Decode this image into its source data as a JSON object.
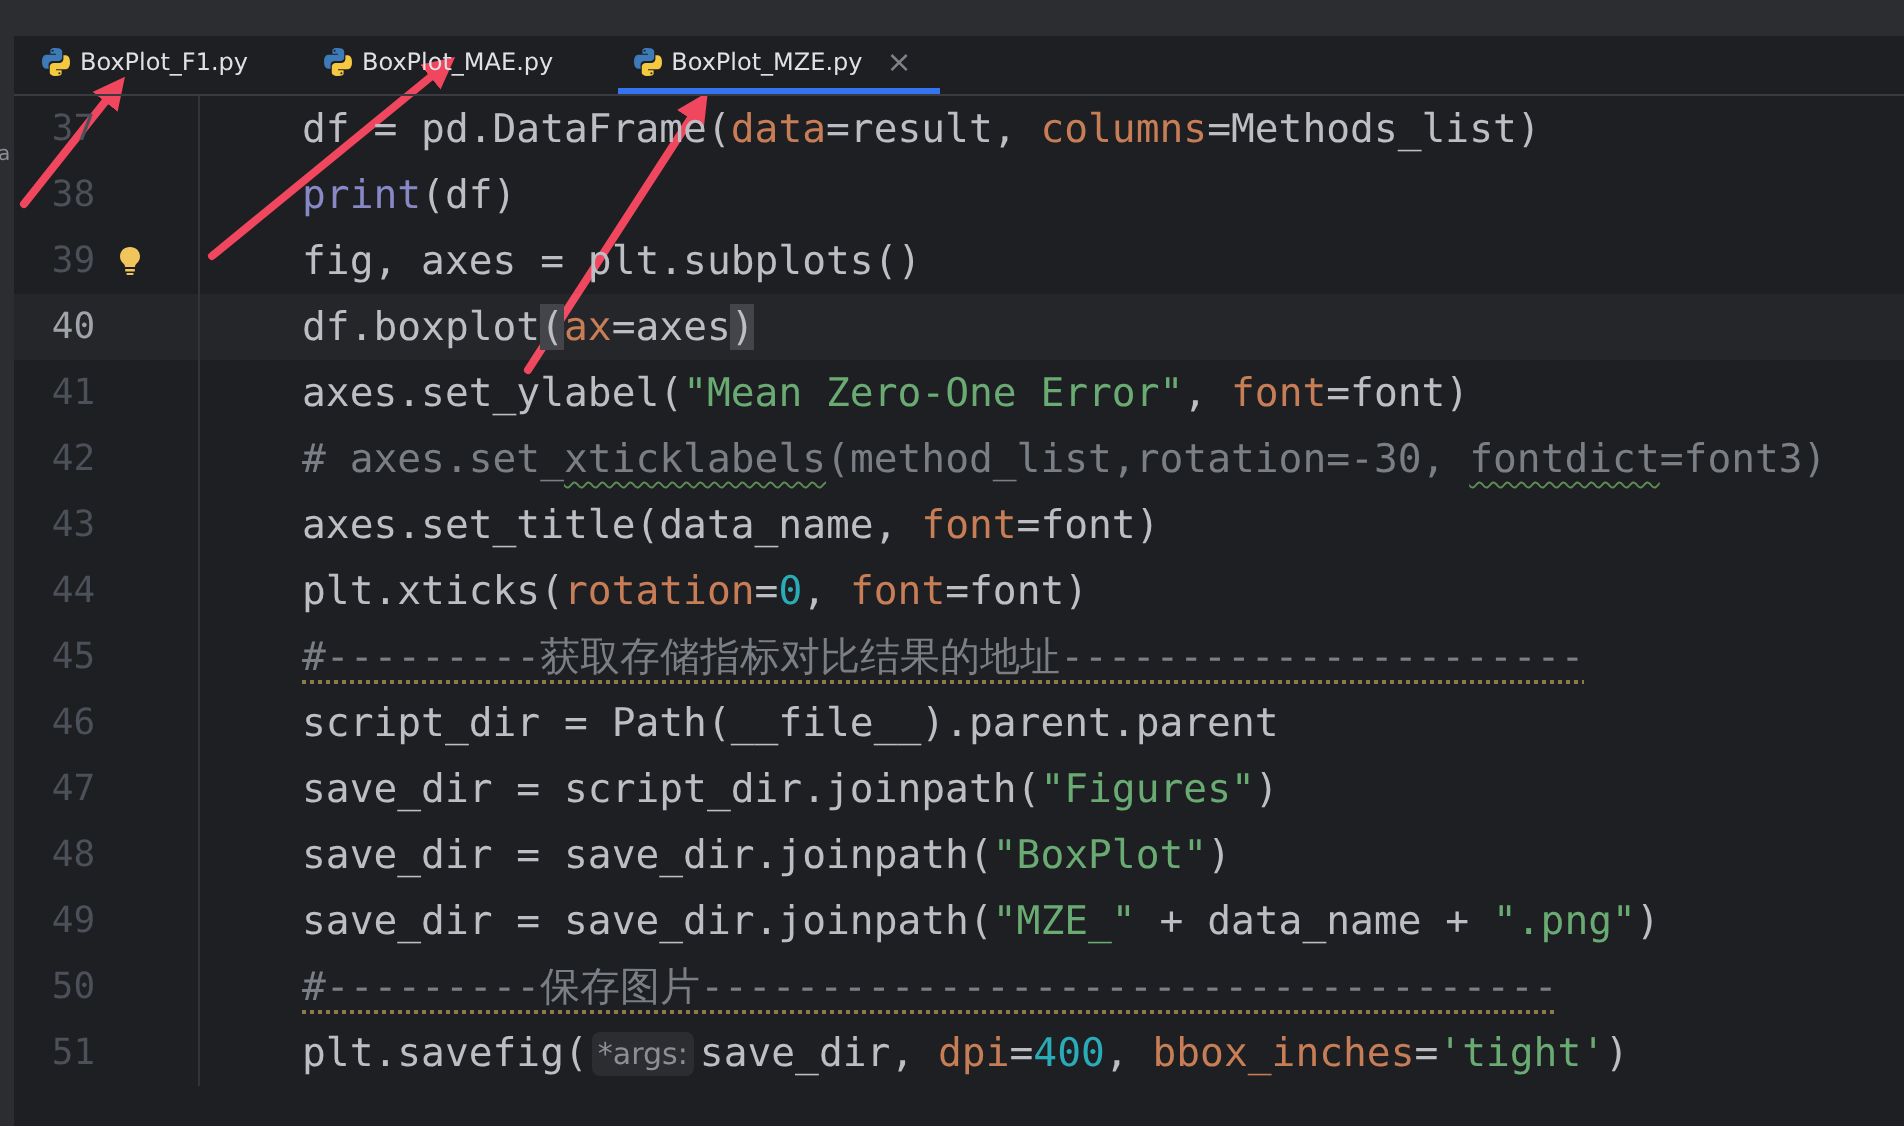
{
  "side_panel": {
    "text": "a"
  },
  "tabs": [
    {
      "label": "BoxPlot_F1.py",
      "selected": false
    },
    {
      "label": "BoxPlot_MAE.py",
      "selected": false
    },
    {
      "label": "BoxPlot_MZE.py",
      "selected": true,
      "close": "×"
    }
  ],
  "editor": {
    "lines": [
      {
        "number": "37",
        "current": false,
        "segments": [
          {
            "t": "df = pd.DataFrame(",
            "kind": "plain"
          },
          {
            "t": "data",
            "kind": "param"
          },
          {
            "t": "=result, ",
            "kind": "plain"
          },
          {
            "t": "columns",
            "kind": "param"
          },
          {
            "t": "=Methods_list)",
            "kind": "plain"
          }
        ]
      },
      {
        "number": "38",
        "current": false,
        "segments": [
          {
            "t": "print",
            "kind": "builtin"
          },
          {
            "t": "(df)",
            "kind": "plain"
          }
        ]
      },
      {
        "number": "39",
        "current": false,
        "lightbulb": true,
        "segments": [
          {
            "t": "fig, axes = plt.subplots()",
            "kind": "plain"
          }
        ]
      },
      {
        "number": "40",
        "current": true,
        "segments": [
          {
            "t": "df.boxplot",
            "kind": "plain"
          },
          {
            "t": "(",
            "kind": "plain",
            "matched": true
          },
          {
            "t": "ax",
            "kind": "param"
          },
          {
            "t": "=axes",
            "kind": "plain"
          },
          {
            "t": ")",
            "kind": "plain",
            "matched": true
          }
        ]
      },
      {
        "number": "41",
        "current": false,
        "segments": [
          {
            "t": "axes.set_ylabel(",
            "kind": "plain"
          },
          {
            "t": "\"Mean Zero-One Error\"",
            "kind": "string"
          },
          {
            "t": ", ",
            "kind": "plain"
          },
          {
            "t": "font",
            "kind": "param"
          },
          {
            "t": "=font)",
            "kind": "plain"
          }
        ]
      },
      {
        "number": "42",
        "current": false,
        "segments": [
          {
            "t": "# axes.set_",
            "kind": "comment"
          },
          {
            "t": "xticklabels",
            "kind": "comment",
            "spellcheck": true
          },
          {
            "t": "(method_list,rotation=-30, ",
            "kind": "comment"
          },
          {
            "t": "fontdict",
            "kind": "comment",
            "spellcheck": true
          },
          {
            "t": "=font3)",
            "kind": "comment"
          }
        ]
      },
      {
        "number": "43",
        "current": false,
        "segments": [
          {
            "t": "axes.set_title(data_name, ",
            "kind": "plain"
          },
          {
            "t": "font",
            "kind": "param"
          },
          {
            "t": "=font)",
            "kind": "plain"
          }
        ]
      },
      {
        "number": "44",
        "current": false,
        "segments": [
          {
            "t": "plt.xticks(",
            "kind": "plain"
          },
          {
            "t": "rotation",
            "kind": "param"
          },
          {
            "t": "=",
            "kind": "plain"
          },
          {
            "t": "0",
            "kind": "number"
          },
          {
            "t": ", ",
            "kind": "plain"
          },
          {
            "t": "font",
            "kind": "param"
          },
          {
            "t": "=font)",
            "kind": "plain"
          }
        ]
      },
      {
        "number": "45",
        "current": false,
        "segments": [
          {
            "t": "#---------获取存储指标对比结果的地址----------------------",
            "kind": "comment",
            "weak_warning": true
          }
        ]
      },
      {
        "number": "46",
        "current": false,
        "segments": [
          {
            "t": "script_dir = Path(__file__).parent.parent",
            "kind": "plain"
          }
        ]
      },
      {
        "number": "47",
        "current": false,
        "segments": [
          {
            "t": "save_dir = script_dir.joinpath(",
            "kind": "plain"
          },
          {
            "t": "\"Figures\"",
            "kind": "string"
          },
          {
            "t": ")",
            "kind": "plain"
          }
        ]
      },
      {
        "number": "48",
        "current": false,
        "segments": [
          {
            "t": "save_dir = save_dir.joinpath(",
            "kind": "plain"
          },
          {
            "t": "\"BoxPlot\"",
            "kind": "string"
          },
          {
            "t": ")",
            "kind": "plain"
          }
        ]
      },
      {
        "number": "49",
        "current": false,
        "segments": [
          {
            "t": "save_dir = save_dir.joinpath(",
            "kind": "plain"
          },
          {
            "t": "\"MZE_\"",
            "kind": "string"
          },
          {
            "t": " + data_name + ",
            "kind": "plain"
          },
          {
            "t": "\".png\"",
            "kind": "string"
          },
          {
            "t": ")",
            "kind": "plain"
          }
        ]
      },
      {
        "number": "50",
        "current": false,
        "segments": [
          {
            "t": "#---------保存图片------------------------------------",
            "kind": "comment",
            "weak_warning": true
          }
        ]
      },
      {
        "number": "51",
        "current": false,
        "segments": [
          {
            "t": "plt.savefig(",
            "kind": "plain"
          },
          {
            "t": "*args:",
            "kind": "hint"
          },
          {
            "t": "save_dir, ",
            "kind": "plain"
          },
          {
            "t": "dpi",
            "kind": "param"
          },
          {
            "t": "=",
            "kind": "plain"
          },
          {
            "t": "400",
            "kind": "number"
          },
          {
            "t": ", ",
            "kind": "plain"
          },
          {
            "t": "bbox_inches",
            "kind": "param"
          },
          {
            "t": "=",
            "kind": "plain"
          },
          {
            "t": "'tight'",
            "kind": "string"
          },
          {
            "t": ")",
            "kind": "plain"
          }
        ]
      }
    ]
  }
}
